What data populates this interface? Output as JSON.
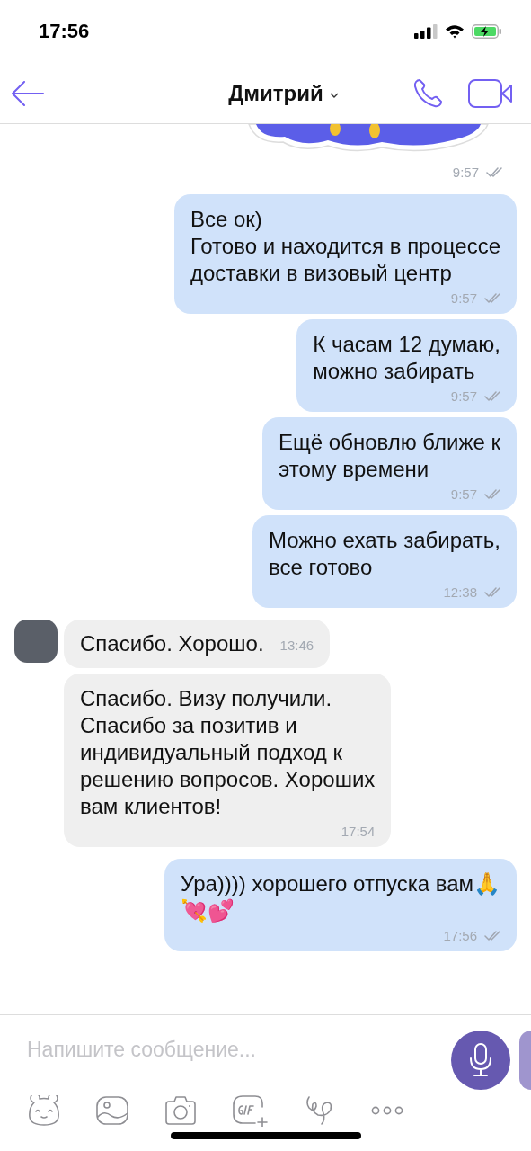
{
  "status_bar": {
    "time": "17:56"
  },
  "header": {
    "title": "Дмитрий"
  },
  "sticker": {
    "time": "9:57",
    "ticks": true
  },
  "messages": [
    {
      "kind": "outgoing",
      "time_inline": false,
      "text": "Все ок)\nГотово и находится в процессе\nдоставки в визовый центр",
      "time": "9:57",
      "ticks": true,
      "avatar": false
    },
    {
      "kind": "outgoing",
      "time_inline": false,
      "text": "К часам 12 думаю,\nможно забирать",
      "time": "9:57",
      "ticks": true,
      "avatar": false
    },
    {
      "kind": "outgoing",
      "time_inline": false,
      "text": "Ещё обновлю ближе к\nэтому времени",
      "time": "9:57",
      "ticks": true,
      "avatar": false
    },
    {
      "kind": "outgoing",
      "time_inline": false,
      "text": "Можно ехать забирать,\nвсе готово",
      "time": "12:38",
      "ticks": true,
      "avatar": false
    },
    {
      "kind": "incoming",
      "time_inline": true,
      "text": "Спасибо. Хорошо.",
      "time": "13:46",
      "ticks": false,
      "avatar": true
    },
    {
      "kind": "incoming",
      "time_inline": false,
      "text": "Спасибо. Визу получили.\nСпасибо за позитив и\nиндивидуальный подход к\nрешению вопросов. Хороших\nвам клиентов!",
      "time": "17:54",
      "ticks": false,
      "avatar": false
    },
    {
      "kind": "outgoing",
      "time_inline": false,
      "text": "Ура)))) хорошего отпуска вам🙏\n💘💕",
      "time": "17:56",
      "ticks": true,
      "avatar": false
    }
  ],
  "composer": {
    "placeholder": "Напишите сообщение..."
  }
}
